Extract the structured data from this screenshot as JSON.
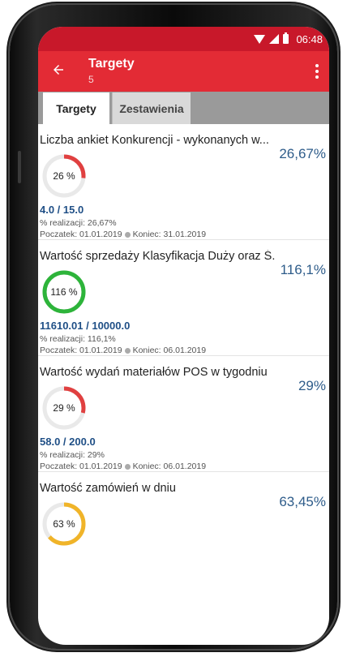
{
  "status_bar": {
    "time": "06:48"
  },
  "app_bar": {
    "title": "Targety",
    "subtitle": "5"
  },
  "tabs": [
    {
      "label": "Targety",
      "active": true
    },
    {
      "label": "Zestawienia",
      "active": false
    }
  ],
  "colors": {
    "status": "#c8182a",
    "appbar": "#e32b35",
    "low": "#e04040",
    "high": "#2db43a",
    "mid": "#f0b429",
    "track": "#e9e9e9"
  },
  "targets": [
    {
      "name": "Liczba ankiet Konkurencji - wykonanych w...",
      "percent_text": "26,67%",
      "donut_label": "26 %",
      "progress": 0.2667,
      "color": "#e04040",
      "ratio": "4.0 / 15.0",
      "realization": "% realizacji: 26,67%",
      "start": "Poczatek: 01.01.2019",
      "end": "Koniec: 31.01.2019"
    },
    {
      "name": "Wartość sprzedaży Klasyfikacja Duży oraz Ś...",
      "percent_text": "116,1%",
      "donut_label": "116 %",
      "progress": 1.0,
      "color": "#2db43a",
      "ratio": "11610.01 / 10000.0",
      "realization": "% realizacji: 116,1%",
      "start": "Poczatek: 01.01.2019",
      "end": "Koniec: 06.01.2019"
    },
    {
      "name": "Wartość wydań materiałów POS w tygodniu",
      "percent_text": "29%",
      "donut_label": "29 %",
      "progress": 0.29,
      "color": "#e04040",
      "ratio": "58.0 / 200.0",
      "realization": "% realizacji: 29%",
      "start": "Poczatek: 01.01.2019",
      "end": "Koniec: 06.01.2019"
    },
    {
      "name": "Wartość zamówień w dniu",
      "percent_text": "63,45%",
      "donut_label": "63 %",
      "progress": 0.6345,
      "color": "#f0b429",
      "ratio": "",
      "realization": "",
      "start": "",
      "end": ""
    }
  ]
}
